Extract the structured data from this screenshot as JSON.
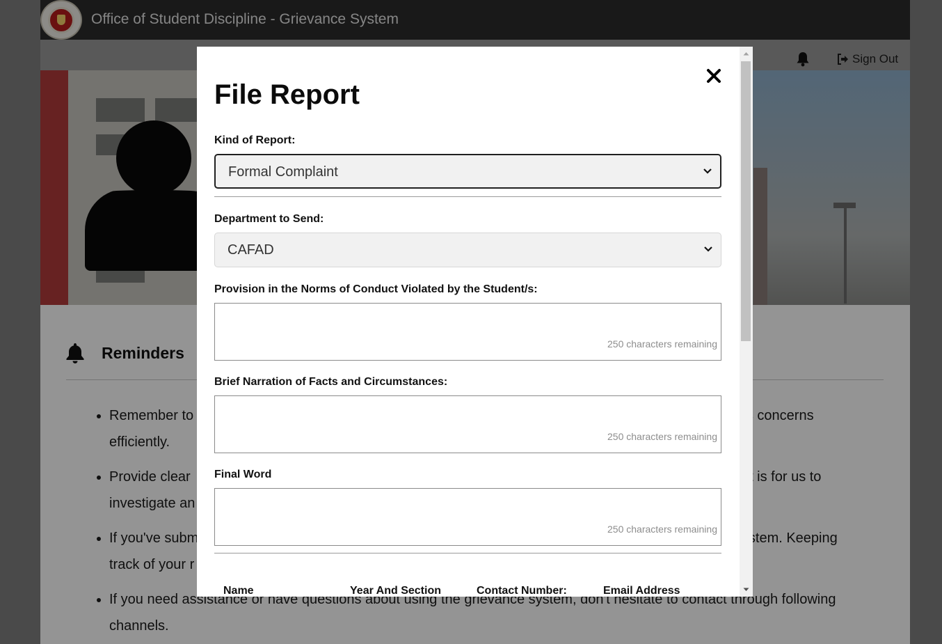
{
  "app": {
    "title": "Office of Student Discipline - Grievance System",
    "logo": "university-seal"
  },
  "header": {
    "notifications_icon": "bell-icon",
    "signout_label": "Sign Out",
    "signout_icon": "sign-out-icon"
  },
  "reminders": {
    "title": "Reminders",
    "items": [
      "Remember to … address concerns efficiently.",
      "Provide clear … er it is for us to investigate an…",
      "If you've subm… system. Keeping track of your r…",
      "If you need assistance or have questions about using the grievance system, don't hesitate to contact through following channels."
    ],
    "items_visible": [
      [
        "Remember to",
        "address concerns",
        "efficiently."
      ],
      [
        "Provide clear",
        "er it is for us to",
        "investigate an"
      ],
      [
        "If you've subm",
        "system. Keeping",
        "track of your r"
      ],
      [
        "If you need assistance or have questions about using the grievance system, don't hesitate to contact through following",
        "channels."
      ]
    ]
  },
  "modal": {
    "title": "File Report",
    "close_icon": "close-icon",
    "kind_of_report": {
      "label": "Kind of Report:",
      "value": "Formal Complaint"
    },
    "department": {
      "label": "Department to Send:",
      "value": "CAFAD"
    },
    "provision": {
      "label": "Provision in the Norms of Conduct Violated by the Student/s:",
      "value": "",
      "counter": "250 characters remaining"
    },
    "narration": {
      "label": "Brief Narration of Facts and Circumstances:",
      "value": "",
      "counter": "250 characters remaining"
    },
    "final_word": {
      "label": "Final Word",
      "value": "",
      "counter": "250 characters remaining"
    },
    "table_headers": [
      "Name",
      "Year And Section",
      "Contact Number:",
      "Email Address"
    ]
  },
  "colors": {
    "topbar": "#2b2b2b",
    "overlay": "rgba(0,0,0,0.42)",
    "modal_bg": "#ffffff",
    "counter_text": "#8d8d8d"
  }
}
